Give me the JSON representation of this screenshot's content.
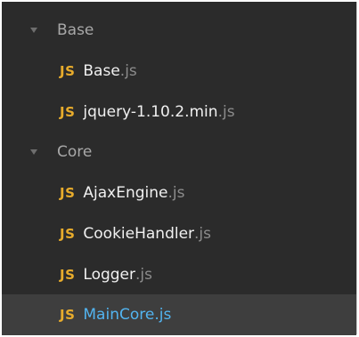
{
  "tree": {
    "folders": [
      {
        "label": "Base",
        "files": [
          {
            "icon": "JS",
            "name": "Base",
            "ext": ".js"
          },
          {
            "icon": "JS",
            "name": "jquery-1.10.2.min",
            "ext": ".js"
          }
        ]
      },
      {
        "label": "Core",
        "files": [
          {
            "icon": "JS",
            "name": "AjaxEngine",
            "ext": ".js"
          },
          {
            "icon": "JS",
            "name": "CookieHandler",
            "ext": ".js"
          },
          {
            "icon": "JS",
            "name": "Logger",
            "ext": ".js"
          },
          {
            "icon": "JS",
            "name": "MainCore.js",
            "ext": ""
          }
        ]
      }
    ],
    "selected_file": "MainCore.js"
  },
  "colors": {
    "panel_bg": "#2b2b2b",
    "selected_bg": "#3e3e3e",
    "js_icon": "#e8ac2c",
    "file_name": "#f0f0f0",
    "file_ext": "#8c8c8c",
    "selected_text": "#52b4f0",
    "folder_text": "#a8a8a8"
  },
  "icons": {
    "folder_expander": "triangle-down-icon",
    "file_type": "js-file-icon"
  }
}
